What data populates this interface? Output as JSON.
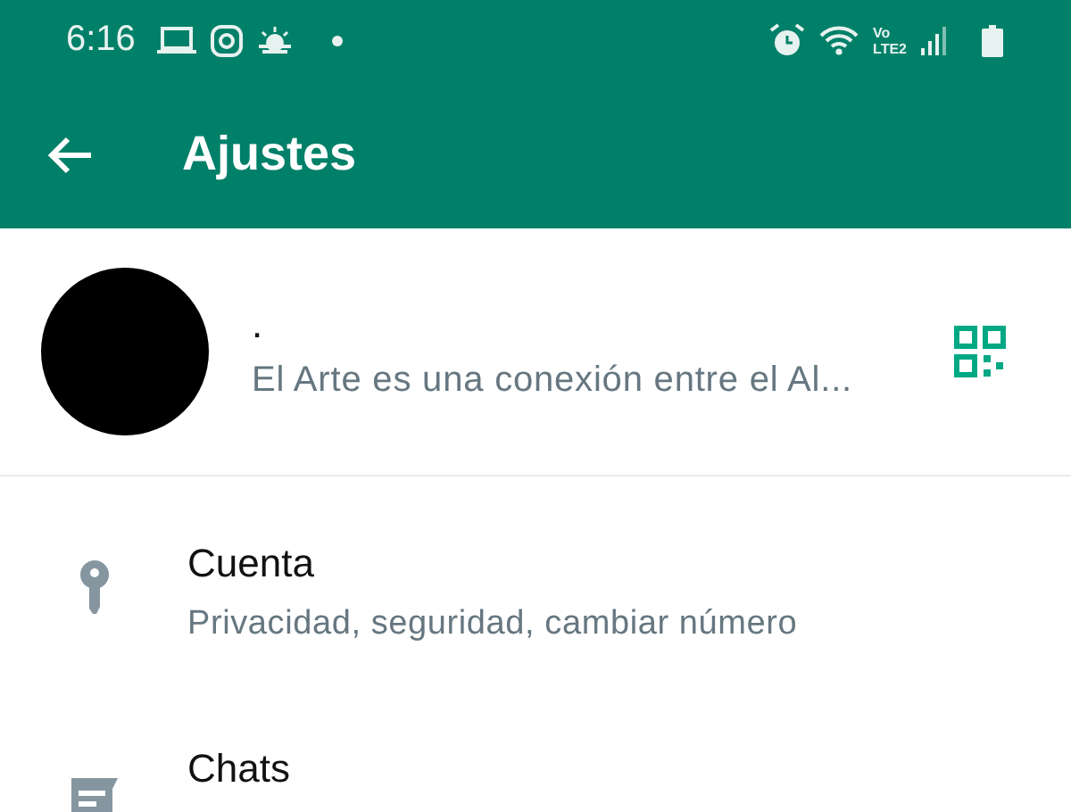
{
  "status_bar": {
    "time": "6:16",
    "network_top": "Vo",
    "network_bottom": "LTE2"
  },
  "app_bar": {
    "title": "Ajustes"
  },
  "profile": {
    "name": ".",
    "about": "El Arte es una conexión entre el Al..."
  },
  "items": [
    {
      "kind": "key",
      "title": "Cuenta",
      "subtitle": "Privacidad, seguridad, cambiar número"
    },
    {
      "kind": "chat",
      "title": "Chats"
    }
  ]
}
